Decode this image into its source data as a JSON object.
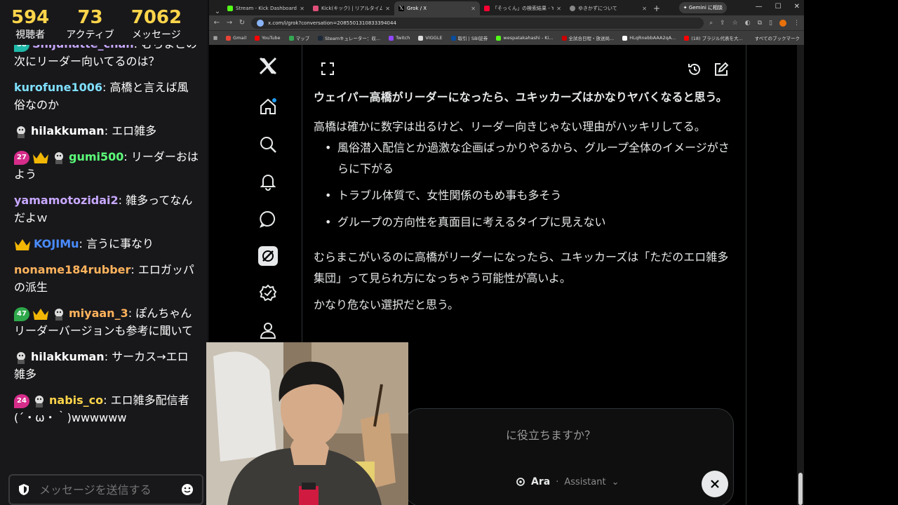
{
  "stats": [
    {
      "num": "594",
      "label": "視聴者"
    },
    {
      "num": "73",
      "label": "アクティブ"
    },
    {
      "num": "7062",
      "label": "メッセージ"
    }
  ],
  "chat": [
    {
      "badges": [
        "subscriber"
      ],
      "user": "Shijunatte_chan",
      "color": "#c8a8ff",
      "text": "むらまこの次にリーダー向いてるのは？",
      "badge_num": "58"
    },
    {
      "badges": [],
      "user": "kurofune1006",
      "color": "#7fe0ff",
      "text": "高橋と言えば風俗なのか"
    },
    {
      "badges": [
        "mascot"
      ],
      "user": "hilakkuman",
      "color": "#ffffff",
      "text": "エロ雑多"
    },
    {
      "badges": [
        "num",
        "crown",
        "mascot"
      ],
      "badge_num": "27",
      "badge_color": "#d62c8a",
      "user": "gumi500",
      "color": "#5cff7a",
      "text": "リーダーおはよう"
    },
    {
      "badges": [],
      "user": "yamamotozidai2",
      "color": "#c8a8ff",
      "text": "雑多ってなんだよｗ"
    },
    {
      "badges": [
        "crown"
      ],
      "user": "KOJIMu",
      "color": "#4a8cff",
      "text": "言うに事なり"
    },
    {
      "badges": [],
      "user": "noname184rubber",
      "color": "#ffb35c",
      "text": "エロガッパの派生"
    },
    {
      "badges": [
        "num",
        "crown",
        "mascot"
      ],
      "badge_num": "47",
      "badge_color": "#2ea84a",
      "user": "miyaan_3",
      "color": "#ffb35c",
      "text": "ぽんちゃんリーダーバージョンも参考に聞いて"
    },
    {
      "badges": [
        "mascot"
      ],
      "user": "hilakkuman",
      "color": "#ffffff",
      "text": "サーカス→エロ雑多"
    },
    {
      "badges": [
        "num",
        "mascot"
      ],
      "badge_num": "24",
      "badge_color": "#d62c8a",
      "user": "nabis_co",
      "color": "#ffd54a",
      "text": "エロ雑多配信者(´・ω・｀)wwwwww"
    }
  ],
  "chat_input": {
    "placeholder": "メッセージを送信する"
  },
  "browser": {
    "tabs": [
      {
        "title": "Stream - Kick Dashboard",
        "color": "#53fc18",
        "active": false
      },
      {
        "title": "Kick(キック) | リアルタイムランキング",
        "color": "#e0507a",
        "active": false
      },
      {
        "title": "Grok / X",
        "color": "#ffffff",
        "active": true
      },
      {
        "title": "「そっくん」の検索結果 - Yahoo!知恵",
        "color": "#ff0033",
        "active": false
      },
      {
        "title": "ゆきかずについて",
        "color": "#888888",
        "active": false
      }
    ],
    "gemini_label": "Gemini に相談",
    "url": "x.com/i/grok?conversation=2085501310833394044",
    "bookmarks": [
      {
        "label": "Gmail",
        "color": "#ea4335"
      },
      {
        "label": "YouTube",
        "color": "#ff0000"
      },
      {
        "label": "マップ",
        "color": "#34a853"
      },
      {
        "label": "Steamキュレーター：収...",
        "color": "#1b2838"
      },
      {
        "label": "Twitch",
        "color": "#9146ff"
      },
      {
        "label": "VIGGLE",
        "color": "#dddddd"
      },
      {
        "label": "取引 | SBI証券",
        "color": "#0a4c9c"
      },
      {
        "label": "wespatakahashi - Ki...",
        "color": "#53fc18"
      },
      {
        "label": "全試合日程・放送局...",
        "color": "#c00"
      },
      {
        "label": "HLqRnebbAAA2qA...",
        "color": "#fff"
      },
      {
        "label": "(18) ブラジル代表を大...",
        "color": "#ff0000"
      }
    ],
    "bookmarks_all": "すべてのブックマーク"
  },
  "grok": {
    "heading": "ウェイパー高橋がリーダーになったら、ユキッカーズはかなりヤバくなると思う。",
    "intro": "高橋は確かに数字は出るけど、リーダー向きじゃない理由がハッキリしてる。",
    "bullets": [
      "風俗潜入配信とか過激な企画ばっかりやるから、グループ全体のイメージがさらに下がる",
      "トラブル体質で、女性関係のもめ事も多そう",
      "グループの方向性を真面目に考えるタイプに見えない"
    ],
    "para2": "むらまこがいるのに高橋がリーダーになったら、ユキッカーズは「ただのエロ雑多集団」って見られ方になっちゃう可能性が高いよ。",
    "para3": "かなり危ない選択だと思う。",
    "composer_placeholder": "に役立ちますか？",
    "model_name": "Ara",
    "model_sep": "·",
    "model_mode": "Assistant"
  },
  "colors": {
    "stat_yellow": "#ffd54a",
    "chat_bg": "#18181b",
    "x_bg": "#000000"
  }
}
